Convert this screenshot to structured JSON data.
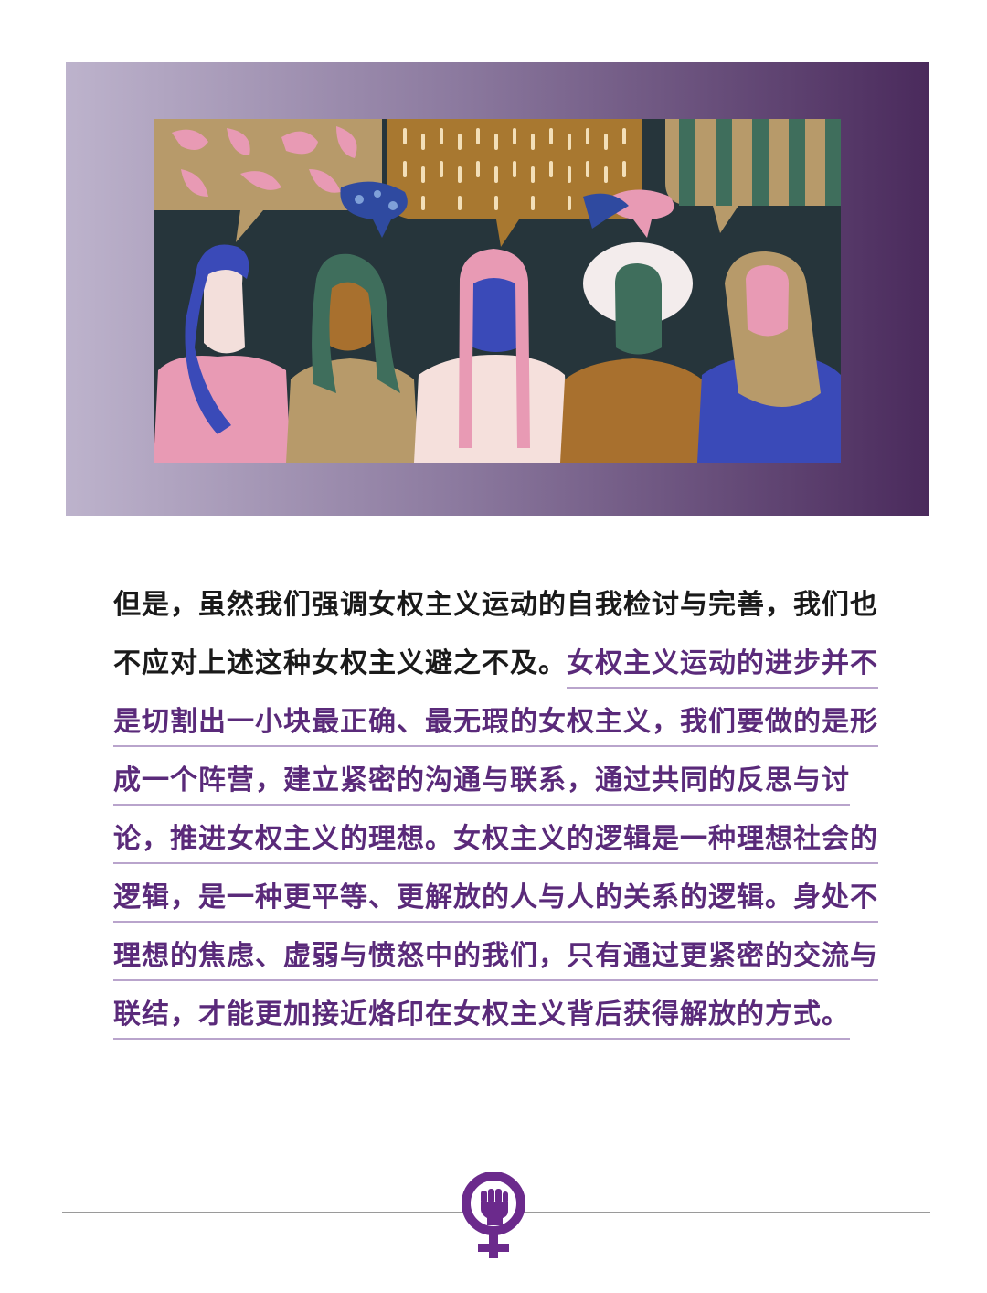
{
  "hero": {
    "illustration": "five-women-with-speech-bubbles-illustration"
  },
  "article": {
    "intro_text": "但是，虽然我们强调女权主义运动的自我检讨与完善，我们也不应对上述这种女权主义避之不及。",
    "highlight_text": "女权主义运动的进步并不是切割出一小块最正确、最无瑕的女权主义，我们要做的是形成一个阵营，建立紧密的沟通与联系，通过共同的反思与讨论，推进女权主义的理想。女权主义的逻辑是一种理想社会的逻辑，是一种更平等、更解放的人与人的关系的逻辑。身处不理想的焦虑、虚弱与愤怒中的我们，只有通过更紧密的交流与联结，才能更加接近烙印在女权主义背后获得解放的方式。"
  },
  "footer": {
    "emblem": "feminist-fist-symbol-icon"
  },
  "colors": {
    "highlight_text": "#5a2a7a",
    "underline": "#b9a4cc",
    "emblem_purple": "#6b2a8c",
    "hero_gradient_start": "#bdb3cc",
    "hero_gradient_end": "#4a2a5c"
  }
}
